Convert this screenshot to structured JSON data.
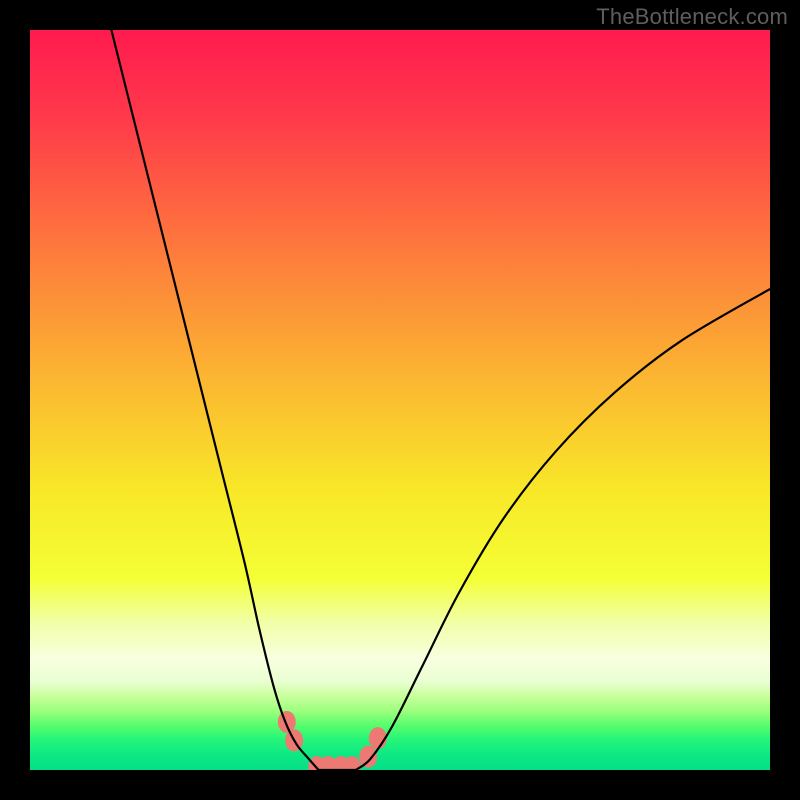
{
  "attribution": "TheBottleneck.com",
  "chart_data": {
    "type": "line",
    "title": "",
    "xlabel": "",
    "ylabel": "",
    "xlim": [
      0,
      100
    ],
    "ylim": [
      0,
      100
    ],
    "grid": false,
    "series": [
      {
        "name": "left-curve",
        "x": [
          11,
          14,
          17,
          20,
          23,
          26,
          29,
          31,
          33,
          34.5,
          36,
          37.5,
          39
        ],
        "y": [
          100,
          88,
          76,
          64,
          52,
          40,
          28,
          19,
          11,
          6.5,
          3.5,
          1.7,
          0.0
        ]
      },
      {
        "name": "right-curve",
        "x": [
          44,
          46,
          49,
          53,
          58,
          64,
          71,
          79,
          88,
          100
        ],
        "y": [
          0.0,
          1.5,
          6,
          14,
          24,
          34,
          43,
          51,
          58,
          65
        ]
      },
      {
        "name": "valley-floor",
        "x": [
          39,
          40,
          41,
          42,
          43,
          44
        ],
        "y": [
          0.0,
          0.0,
          0.0,
          0.0,
          0.0,
          0.0
        ]
      }
    ],
    "markers": {
      "comment": "salmon rounded markers along the valley",
      "color": "#ec7a73",
      "points": [
        {
          "x": 34.7,
          "y": 6.5
        },
        {
          "x": 35.7,
          "y": 4.0
        },
        {
          "x": 38.8,
          "y": 0.4
        },
        {
          "x": 40.3,
          "y": 0.4
        },
        {
          "x": 42.0,
          "y": 0.4
        },
        {
          "x": 43.5,
          "y": 0.4
        },
        {
          "x": 45.7,
          "y": 1.8
        },
        {
          "x": 47.0,
          "y": 4.3
        }
      ]
    },
    "background_gradient": {
      "stops": [
        {
          "pct": 0,
          "color": "#ff1a4f"
        },
        {
          "pct": 12,
          "color": "#ff3a4a"
        },
        {
          "pct": 30,
          "color": "#fd7b3c"
        },
        {
          "pct": 48,
          "color": "#fbb931"
        },
        {
          "pct": 62,
          "color": "#f8e728"
        },
        {
          "pct": 74,
          "color": "#f4ff35"
        },
        {
          "pct": 80,
          "color": "#f1ffa6"
        },
        {
          "pct": 85,
          "color": "#f7ffe0"
        },
        {
          "pct": 88,
          "color": "#eaffd2"
        },
        {
          "pct": 90,
          "color": "#c8ff9d"
        },
        {
          "pct": 92,
          "color": "#9cff7e"
        },
        {
          "pct": 94,
          "color": "#57fd6d"
        },
        {
          "pct": 96,
          "color": "#22f579"
        },
        {
          "pct": 98,
          "color": "#0de884"
        },
        {
          "pct": 100,
          "color": "#05df86"
        }
      ]
    }
  }
}
